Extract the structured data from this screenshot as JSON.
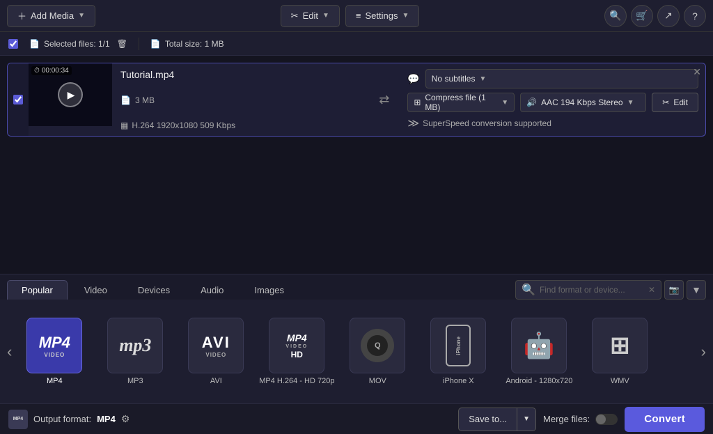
{
  "toolbar": {
    "add_media": "Add Media",
    "edit": "Edit",
    "settings": "Settings",
    "search_placeholder": "Find format or device..."
  },
  "file_bar": {
    "selected_label": "Selected files: 1/1",
    "total_size": "Total size: 1 MB"
  },
  "file_card": {
    "thumb_time": "00:00:34",
    "name": "Tutorial.mp4",
    "size": "3 MB",
    "codec": "H.264 1920x1080 509 Kbps",
    "output_name": "Tutorial.mp4",
    "compress": "Compress file (1 MB)",
    "audio": "AAC 194 Kbps Stereo",
    "subtitles": "No subtitles",
    "superspeed": "SuperSpeed conversion supported",
    "edit_label": "Edit"
  },
  "tabs": [
    {
      "id": "popular",
      "label": "Popular",
      "active": true
    },
    {
      "id": "video",
      "label": "Video",
      "active": false
    },
    {
      "id": "devices",
      "label": "Devices",
      "active": false
    },
    {
      "id": "audio",
      "label": "Audio",
      "active": false
    },
    {
      "id": "images",
      "label": "Images",
      "active": false
    }
  ],
  "formats": [
    {
      "id": "mp4",
      "label": "MP4",
      "type": "mp4",
      "selected": true
    },
    {
      "id": "mp3",
      "label": "MP3",
      "type": "mp3",
      "selected": false
    },
    {
      "id": "avi",
      "label": "AVI",
      "type": "avi",
      "selected": false
    },
    {
      "id": "mp4hd",
      "label": "MP4 H.264 - HD 720p",
      "type": "mp4hd",
      "selected": false
    },
    {
      "id": "mov",
      "label": "MOV",
      "type": "mov",
      "selected": false
    },
    {
      "id": "iphonex",
      "label": "iPhone X",
      "type": "iphone",
      "selected": false
    },
    {
      "id": "android",
      "label": "Android - 1280x720",
      "type": "android",
      "selected": false
    },
    {
      "id": "wmv",
      "label": "WMV",
      "type": "wmv",
      "selected": false
    }
  ],
  "status_bar": {
    "output_label": "Output format:",
    "output_format": "MP4",
    "save_to": "Save to...",
    "merge_files": "Merge files:",
    "convert": "Convert"
  }
}
